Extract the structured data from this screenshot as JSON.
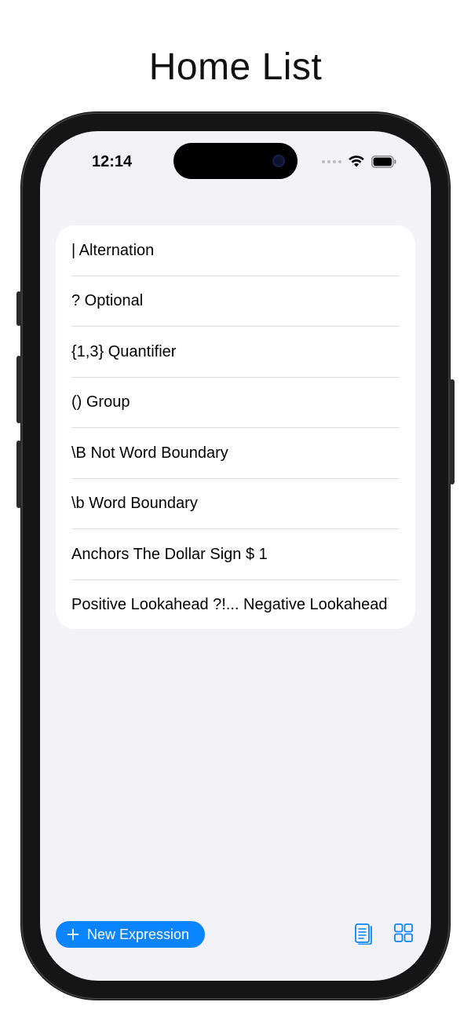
{
  "page": {
    "title": "Home List"
  },
  "status_bar": {
    "time": "12:14",
    "wifi_icon": "wifi-icon",
    "battery_icon": "battery-icon"
  },
  "list": {
    "items": [
      {
        "label": "| Alternation"
      },
      {
        "label": "? Optional"
      },
      {
        "label": "{1,3} Quantifier"
      },
      {
        "label": "() Group"
      },
      {
        "label": "\\B Not Word Boundary"
      },
      {
        "label": "\\b Word Boundary"
      },
      {
        "label": "Anchors The Dollar Sign $ 1"
      },
      {
        "label": "Positive Lookahead ?!... Negative Lookahead"
      }
    ]
  },
  "toolbar": {
    "new_button_label": "New Expression",
    "new_button_icon": "plus-icon",
    "left_tool_icon": "document-stack-icon",
    "right_tool_icon": "grid-icon"
  },
  "colors": {
    "accent": "#0a84ff",
    "background": "#f2f2f7",
    "card": "#ffffff",
    "separator": "#dedee2"
  }
}
